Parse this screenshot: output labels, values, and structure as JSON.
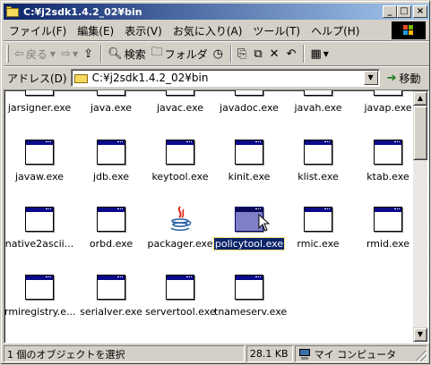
{
  "window": {
    "title": "C:¥j2sdk1.4.2_02¥bin"
  },
  "menu": [
    "ファイル(F)",
    "編集(E)",
    "表示(V)",
    "お気に入り(A)",
    "ツール(T)",
    "ヘルプ(H)"
  ],
  "toolbar": {
    "back": "戻る",
    "search": "検索",
    "folders": "フォルダ"
  },
  "address": {
    "label": "アドレス(D)",
    "value": "C:¥j2sdk1.4.2_02¥bin",
    "go": "移動"
  },
  "files": [
    {
      "name": "jarsigner.exe",
      "type": "exe"
    },
    {
      "name": "java.exe",
      "type": "exe"
    },
    {
      "name": "javac.exe",
      "type": "exe"
    },
    {
      "name": "javadoc.exe",
      "type": "exe"
    },
    {
      "name": "javah.exe",
      "type": "exe"
    },
    {
      "name": "javap.exe",
      "type": "exe"
    },
    {
      "name": "javaw.exe",
      "type": "exe"
    },
    {
      "name": "jdb.exe",
      "type": "exe"
    },
    {
      "name": "keytool.exe",
      "type": "exe"
    },
    {
      "name": "kinit.exe",
      "type": "exe"
    },
    {
      "name": "klist.exe",
      "type": "exe"
    },
    {
      "name": "ktab.exe",
      "type": "exe"
    },
    {
      "name": "native2ascii...",
      "type": "exe"
    },
    {
      "name": "orbd.exe",
      "type": "exe"
    },
    {
      "name": "packager.exe",
      "type": "java"
    },
    {
      "name": "policytool.exe",
      "type": "exe",
      "selected": true
    },
    {
      "name": "rmic.exe",
      "type": "exe"
    },
    {
      "name": "rmid.exe",
      "type": "exe"
    },
    {
      "name": "rmiregistry.e...",
      "type": "exe"
    },
    {
      "name": "serialver.exe",
      "type": "exe"
    },
    {
      "name": "servertool.exe",
      "type": "exe"
    },
    {
      "name": "tnameserv.exe",
      "type": "exe"
    }
  ],
  "status": {
    "selection": "1 個のオブジェクトを選択",
    "size": "28.1 KB",
    "zone": "マイ コンピュータ"
  }
}
